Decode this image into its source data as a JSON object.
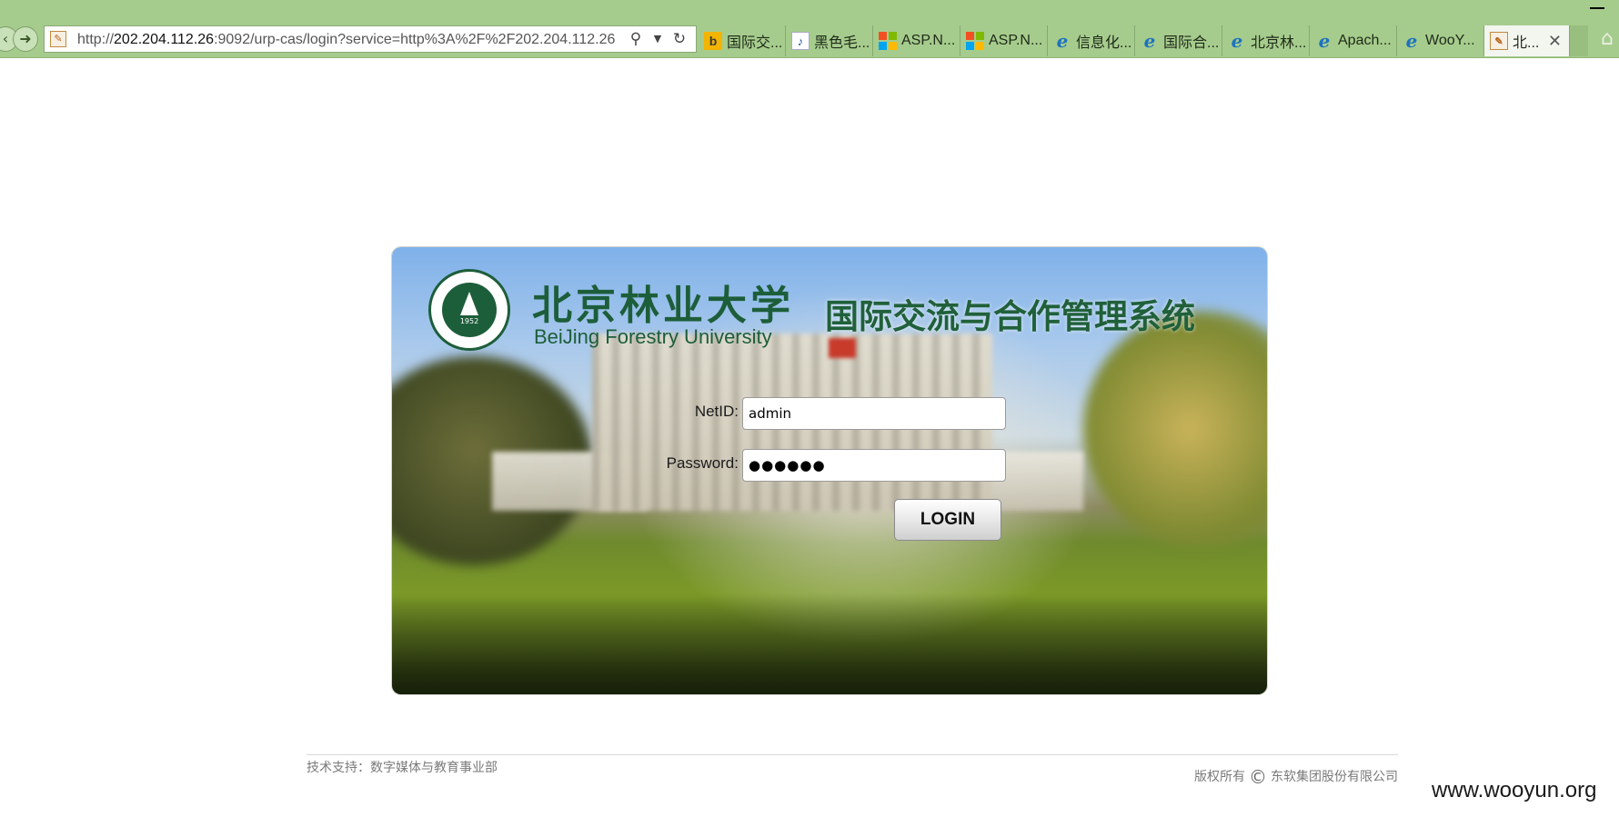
{
  "browser": {
    "url_prefix": "http://",
    "url_host": "202.204.112.26",
    "url_rest": ":9092/urp-cas/login?service=http%3A%2F%2F202.204.112.26",
    "tabs": [
      {
        "label": "国际交...",
        "icon": "bing-icon"
      },
      {
        "label": "黑色毛...",
        "icon": "music-icon"
      },
      {
        "label": "ASP.N...",
        "icon": "microsoft-icon"
      },
      {
        "label": "ASP.N...",
        "icon": "microsoft-icon"
      },
      {
        "label": "信息化...",
        "icon": "ie-icon"
      },
      {
        "label": "国际合...",
        "icon": "ie-icon"
      },
      {
        "label": "北京林...",
        "icon": "ie-icon"
      },
      {
        "label": "Apach...",
        "icon": "ie-icon"
      },
      {
        "label": "WooY...",
        "icon": "ie-icon"
      },
      {
        "label": "北...",
        "icon": "page-icon"
      }
    ],
    "accent_color": "#a6cc8d"
  },
  "login": {
    "brand_cn": "北京林业大学",
    "brand_en": "BeiJing Forestry University",
    "seal_year": "1952",
    "system_title": "国际交流与合作管理系统",
    "netid_label": "NetID:",
    "netid_value": "admin",
    "password_label": "Password:",
    "password_value": "●●●●●●",
    "login_button": "LOGIN"
  },
  "footer": {
    "support": "技术支持：数字媒体与教育事业部",
    "copyright_prefix": "版权所有",
    "copyright_symbol": "©",
    "copyright_company": "东软集团股份有限公司"
  },
  "watermark": "www.wooyun.org"
}
